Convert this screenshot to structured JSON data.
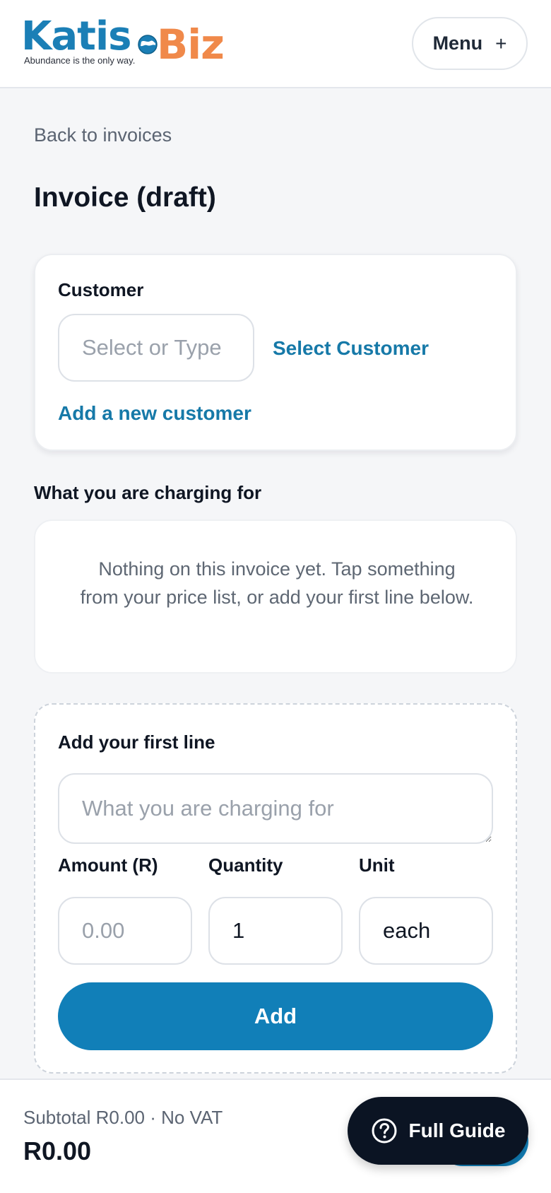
{
  "header": {
    "logo": {
      "name_part1": "Katis",
      "name_part2": "Biz",
      "tagline": "Abundance is the only way."
    },
    "menu_label": "Menu",
    "menu_icon": "plus-icon"
  },
  "page": {
    "back_link": "Back to invoices",
    "title": "Invoice (draft)"
  },
  "customer_card": {
    "label": "Customer",
    "input_placeholder": "Select or Type",
    "input_value": "",
    "select_link": "Select Customer",
    "add_link": "Add a new customer"
  },
  "charges": {
    "heading": "What you are charging for",
    "empty_message": "Nothing on this invoice yet. Tap something from your price list, or add your first line below."
  },
  "add_line": {
    "heading": "Add your first line",
    "description_placeholder": "What you are charging for",
    "amount_label": "Amount (R)",
    "amount_placeholder": "0.00",
    "quantity_label": "Quantity",
    "quantity_value": "1",
    "unit_label": "Unit",
    "unit_value": "each",
    "add_button": "Add"
  },
  "footer": {
    "subtotal_text": "Subtotal R0.00 · No VAT",
    "total": "R0.00",
    "guide_button": "Full Guide",
    "guide_icon": "question-circle-icon"
  },
  "colors": {
    "brand_blue": "#117fb8",
    "brand_orange": "#f0894a",
    "dark": "#0b1423",
    "background": "#f5f6f8"
  }
}
